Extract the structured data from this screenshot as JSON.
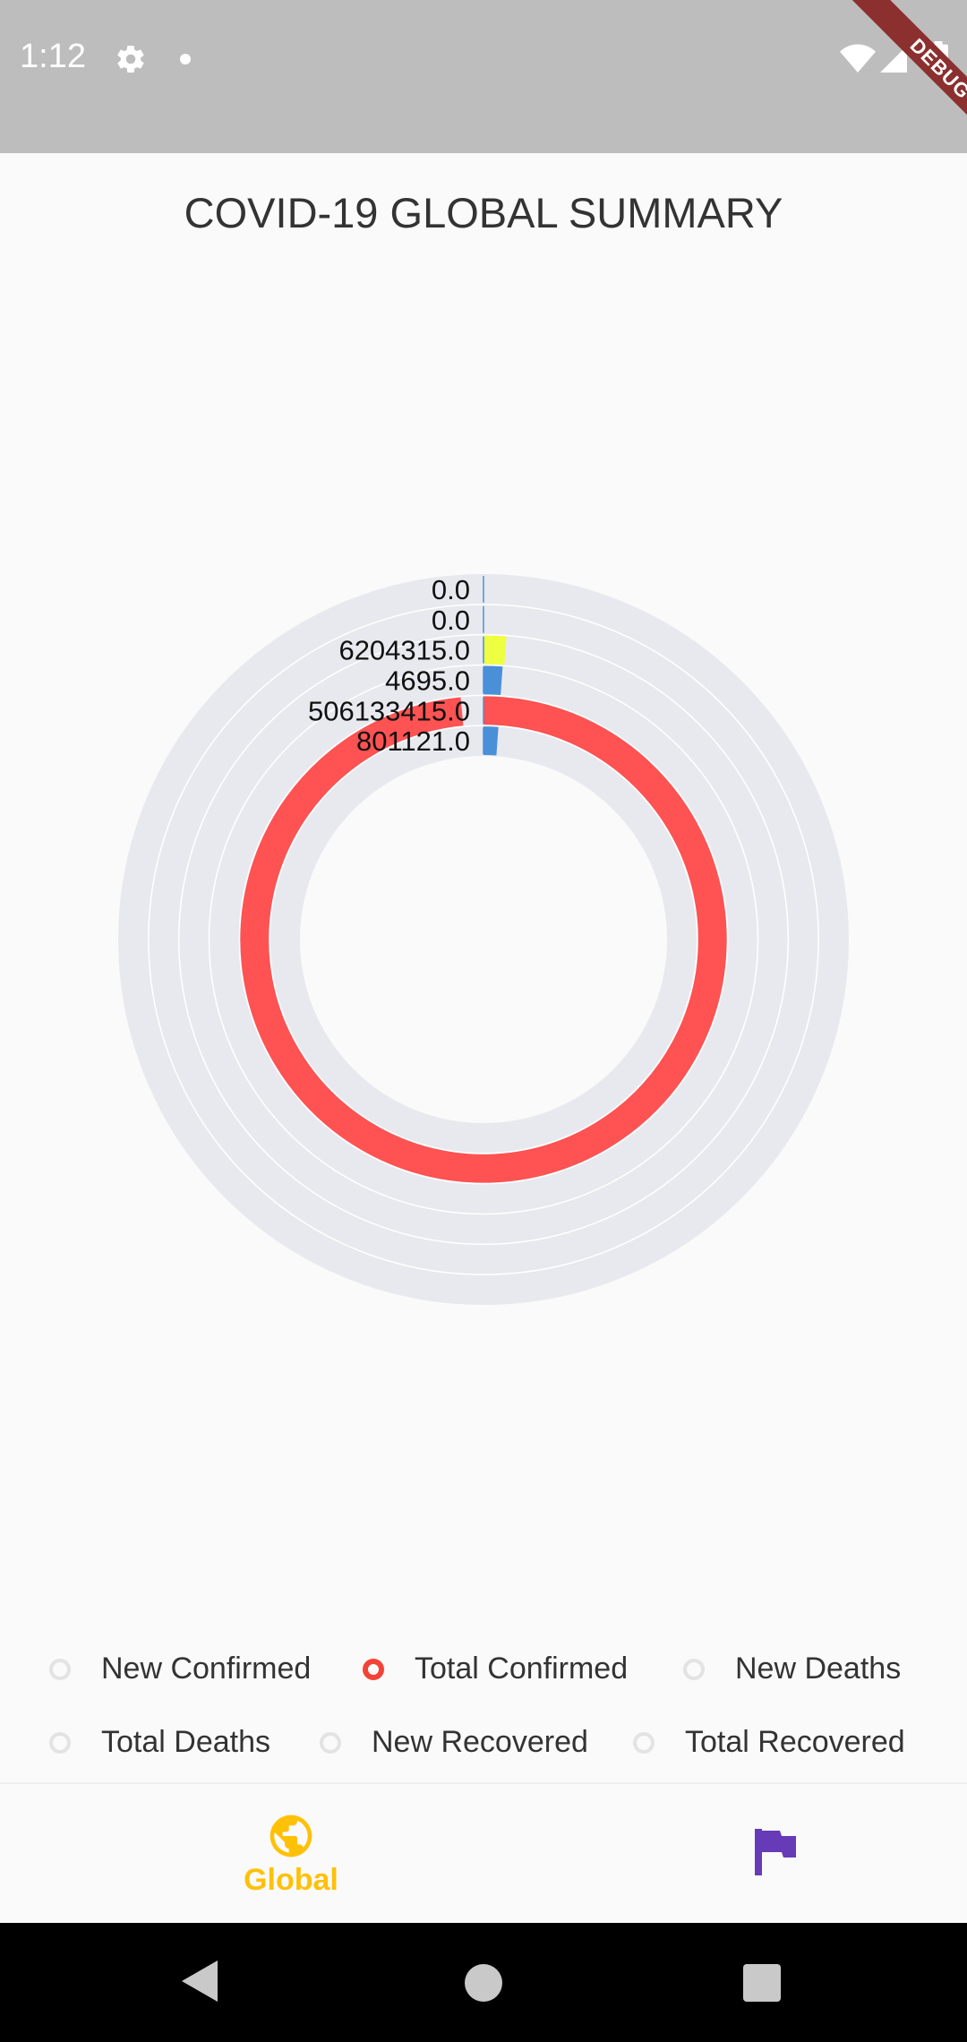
{
  "status_bar": {
    "time": "1:12",
    "debug_label": "DEBUG",
    "icons": [
      "gear-icon",
      "notification-dot-icon",
      "wifi-icon",
      "signal-icon",
      "battery-icon"
    ]
  },
  "header": {
    "title": "COVID-19 GLOBAL SUMMARY"
  },
  "chart_data": {
    "type": "radial-bar",
    "track_color": "#e8e9ee",
    "series": [
      {
        "label": "0.0",
        "value": 0.0,
        "color": "#4a90d9"
      },
      {
        "label": "0.0",
        "value": 0.0,
        "color": "#4a90d9"
      },
      {
        "label": "6204315.0",
        "value": 6204315.0,
        "color": "#eeff41"
      },
      {
        "label": "4695.0",
        "value": 4695.0,
        "color": "#4a90d9"
      },
      {
        "label": "506133415.0",
        "value": 506133415.0,
        "color": "#ff5252"
      },
      {
        "label": "801121.0",
        "value": 801121.0,
        "color": "#4a90d9"
      }
    ]
  },
  "legend": {
    "items": [
      {
        "label": "New Confirmed",
        "active": false
      },
      {
        "label": "Total Confirmed",
        "active": true
      },
      {
        "label": "New Deaths",
        "active": false
      },
      {
        "label": "Total Deaths",
        "active": false
      },
      {
        "label": "New Recovered",
        "active": false
      },
      {
        "label": "Total Recovered",
        "active": false
      }
    ]
  },
  "bottom_nav": {
    "global_label": "Global",
    "global_color": "#ffc107",
    "country_color": "#673ab7",
    "icons": [
      "globe-icon",
      "flag-icon"
    ]
  },
  "android_nav": {
    "icons": [
      "back-icon",
      "home-icon",
      "recent-apps-icon"
    ]
  }
}
